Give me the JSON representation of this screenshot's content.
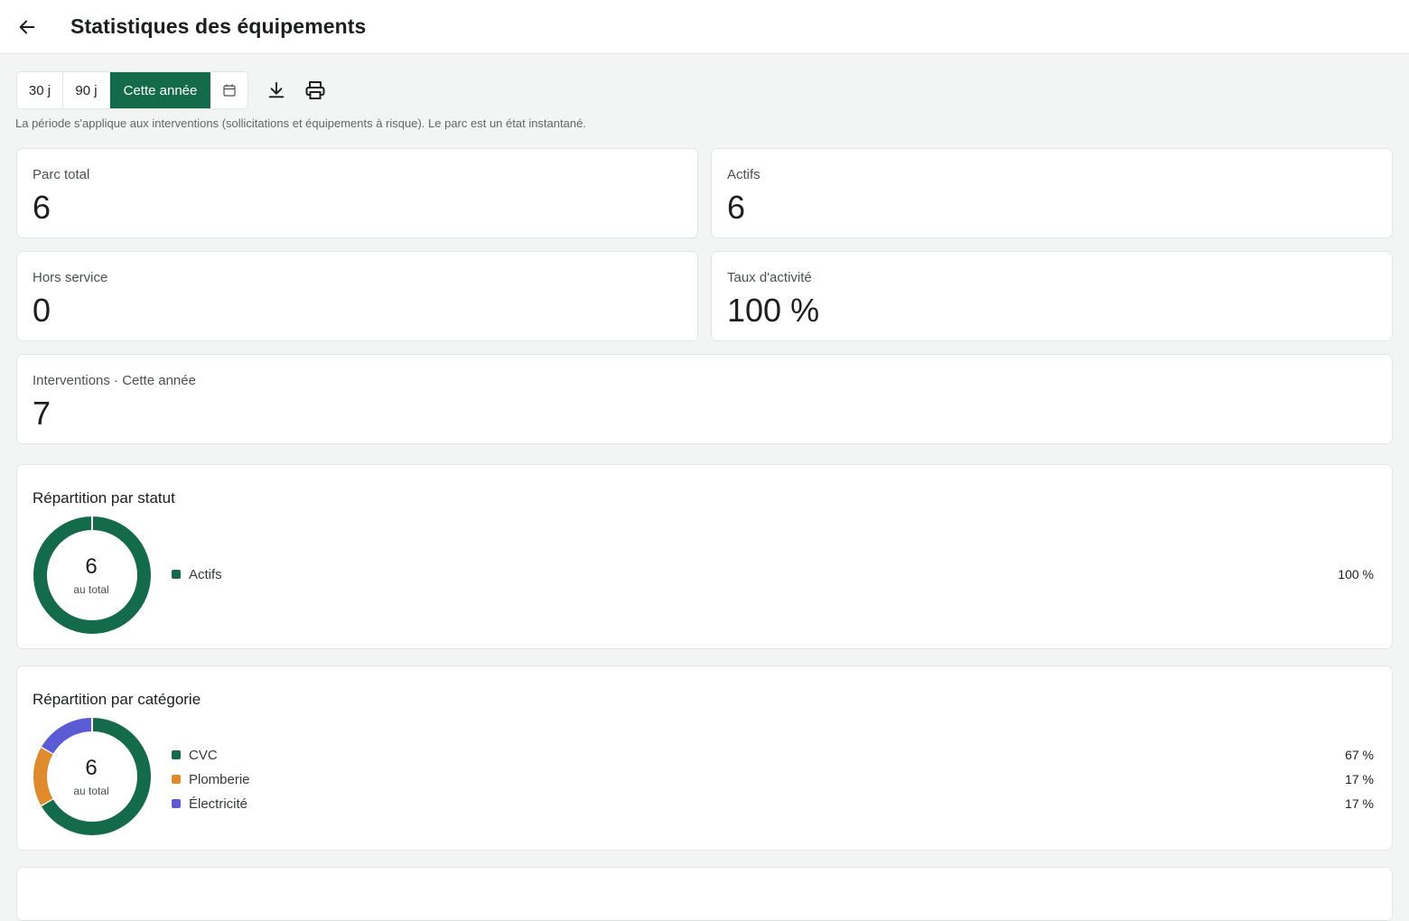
{
  "header": {
    "title": "Statistiques des équipements",
    "back_icon": "arrow-left-icon"
  },
  "toolbar": {
    "periods": [
      "30 j",
      "90 j",
      "Cette année"
    ],
    "selected_period": "Cette année",
    "calendar_icon": "calendar-icon",
    "download_icon": "download-icon",
    "print_icon": "printer-icon",
    "hint": "La période s'applique aux interventions (sollicitations et équipements à risque). Le parc est un état instantané."
  },
  "kpis": {
    "parc_total": {
      "label": "Parc total",
      "value": "6"
    },
    "actifs": {
      "label": "Actifs",
      "value": "6"
    },
    "hors_service": {
      "label": "Hors service",
      "value": "0"
    },
    "taux_activite": {
      "label": "Taux d'activité",
      "value": "100 %"
    },
    "interventions": {
      "label": "Interventions · Cette année",
      "value": "7"
    }
  },
  "colors": {
    "green": "#136b4b",
    "orange": "#e08a2e",
    "blue": "#5b5bd6"
  },
  "chart_data": [
    {
      "type": "pie",
      "title": "Répartition par statut",
      "center_value": "6",
      "center_label": "au total",
      "categories": [
        "Actifs"
      ],
      "values": [
        6
      ],
      "percent_labels": [
        "100 %"
      ],
      "colors": [
        "#136b4b"
      ]
    },
    {
      "type": "pie",
      "title": "Répartition par catégorie",
      "center_value": "6",
      "center_label": "au total",
      "categories": [
        "CVC",
        "Plomberie",
        "Électricité"
      ],
      "values": [
        4,
        1,
        1
      ],
      "percent_labels": [
        "67 %",
        "17 %",
        "17 %"
      ],
      "colors": [
        "#136b4b",
        "#e08a2e",
        "#5b5bd6"
      ]
    }
  ]
}
